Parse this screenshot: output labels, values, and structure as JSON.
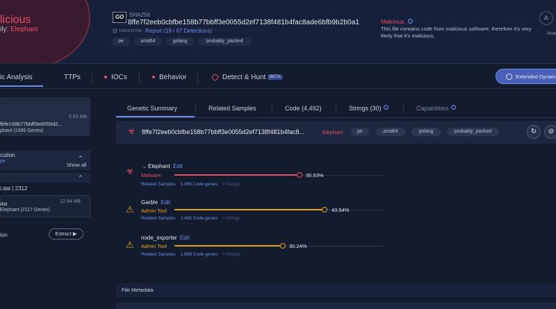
{
  "header": {
    "verdict": "licious",
    "family_prefix": "ily:",
    "family_name": "Elephant",
    "go_logo": "GO",
    "sha_label": "SHA256",
    "sha_value": "8ffe7f2eeb0cbfbe158b77bbff3e0055d2ef7138f481b4fac8ade6bfb9b2b0a1",
    "vt_label": "VIRUSTOTAL",
    "vt_report": "Report (19 / 67 Detections)",
    "tags": [
      "pe",
      "amd64",
      "golang",
      "probably_packed"
    ],
    "malicious_title": "Malicious.",
    "malicious_desc": "This file contains code from malicious software, therefore it's very likely that it's malicious.",
    "action_label": "Ana"
  },
  "main_tabs": {
    "genetic": "ic Analysis",
    "ttps": "TTPs",
    "iocs": "IOCs",
    "behavior": "Behavior",
    "detect": "Detect & Hunt",
    "beta": "BETA",
    "extended": "Extended Dynam"
  },
  "left": {
    "file_name": "fbfe158b77bbff3e0055d2...",
    "file_size": "5.83 MB",
    "file_genes": "phant (1995 Genes)",
    "exec_label": "cution",
    "exec_sub": "pe",
    "show_all": "Show all",
    "dat_row": "i.dat | 2312",
    "dat_name": "dat",
    "dat_size": "12.94 MB",
    "dat_genes": "Elephant (2117 Genes)",
    "extract_label": "ion",
    "extract_btn": "Extract"
  },
  "sub_tabs": {
    "genetic_summary": "Genetic Summary",
    "related_samples": "Related Samples",
    "code": "Code (4,492)",
    "strings": "Strings (30)",
    "capabilities": "Capabilities"
  },
  "hash_bar": {
    "hash": "8ffe7f2eeb0cbfbe158b77bbff3e0055d2ef7138f481b4fac8...",
    "family": "Elephant",
    "tags": [
      "pe",
      "amd64",
      "golang",
      "probably_packed"
    ]
  },
  "genes": [
    {
      "name": "Elephant",
      "edit": "Edit",
      "type": "Malware",
      "pct": "35.53%",
      "fill": 0.3553,
      "related": "Related Samples",
      "code": "1,995 Code genes",
      "strings": "0 Strings",
      "color": "#e8506a",
      "collapsible": true
    },
    {
      "name": "Garble",
      "edit": "Edit",
      "type": "Admin Tool",
      "pct": "43.54%",
      "fill": 0.4354,
      "related": "Related Samples",
      "code": "2,445 Code genes",
      "strings": "0 Strings",
      "color": "#e8a317",
      "collapsible": false
    },
    {
      "name": "node_exporter",
      "edit": "Edit",
      "type": "Admin Tool",
      "pct": "30.24%",
      "fill": 0.3024,
      "related": "Related Samples",
      "code": "1,698 Code genes",
      "strings": "0 Strings",
      "color": "#e8a317",
      "collapsible": false
    }
  ],
  "file_metadata_label": "File Metadata",
  "icons": {
    "vt": "virustotal-icon",
    "bug": "bug-icon",
    "warning": "warning-icon",
    "refresh": "refresh-icon",
    "disable": "block-icon"
  }
}
